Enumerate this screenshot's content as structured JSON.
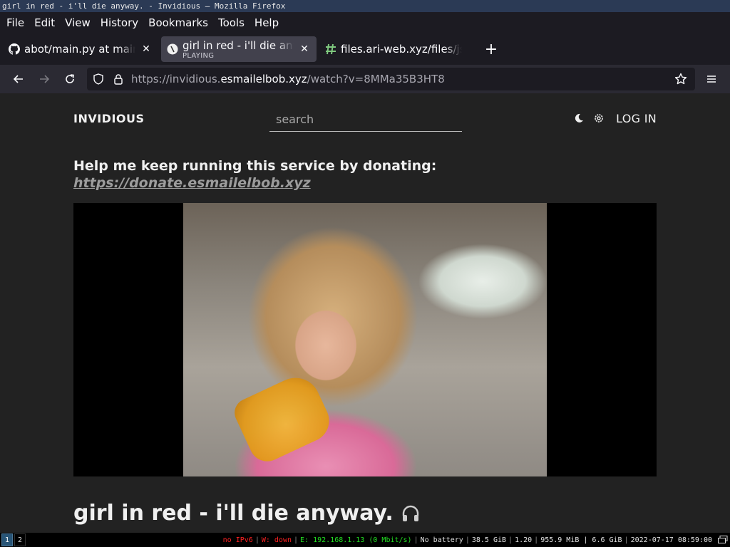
{
  "window": {
    "title": "girl in red - i'll die anyway. - Invidious — Mozilla Firefox"
  },
  "menubar": {
    "items": [
      {
        "label": "File"
      },
      {
        "label": "Edit"
      },
      {
        "label": "View"
      },
      {
        "label": "History"
      },
      {
        "label": "Bookmarks"
      },
      {
        "label": "Tools"
      },
      {
        "label": "Help"
      }
    ]
  },
  "tabs": [
    {
      "title": "abot/main.py at main",
      "icon": "github-icon",
      "active": false
    },
    {
      "title": "girl in red - i'll die anyway.",
      "subtitle": "PLAYING",
      "icon": "invidious-favicon-icon",
      "active": true
    },
    {
      "title": "files.ari-web.xyz/files/js",
      "icon": "file-hash-icon",
      "active": false
    }
  ],
  "urlbar": {
    "url_prefix": "https://invidious.",
    "url_host": "esmailelbob.xyz",
    "url_path": "/watch?v=8MMa35B3HT8"
  },
  "site": {
    "brand": "INVIDIOUS",
    "search_placeholder": "search",
    "login_label": "LOG IN",
    "donate_text": "Help me keep running this service by donating:",
    "donate_link": "https://donate.esmailelbob.xyz",
    "video_title": "girl in red - i'll die anyway."
  },
  "statusbar": {
    "workspaces": [
      {
        "label": "1",
        "active": true
      },
      {
        "label": "2",
        "active": false
      }
    ],
    "ipv6": "no IPv6",
    "wireless": "W: down",
    "ethernet": "E: 192.168.1.13 (0 Mbit/s)",
    "battery": "No battery",
    "disk": "38.5 GiB",
    "load": "1.20",
    "memory": "955.9 MiB | 6.6 GiB",
    "datetime": "2022-07-17 08:59:00",
    "colors": {
      "bad": "#ff2222",
      "good": "#22dd22",
      "active_workspace": "#285577"
    }
  }
}
